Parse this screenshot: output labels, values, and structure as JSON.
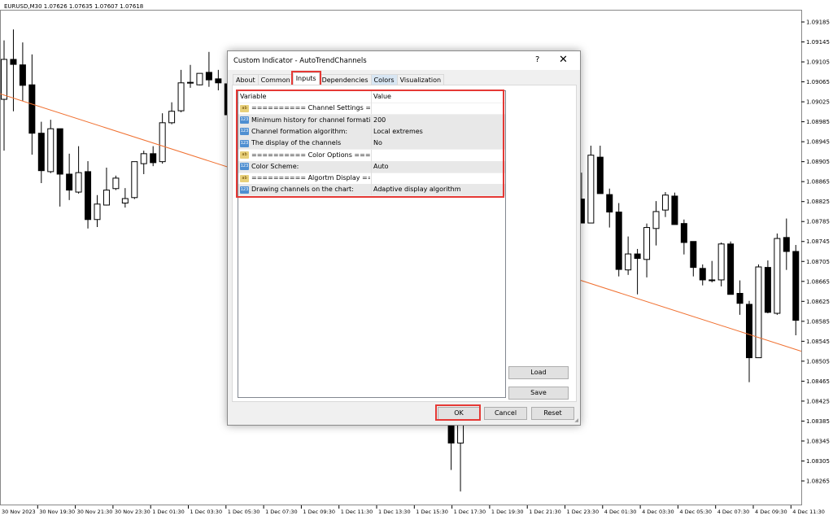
{
  "chart": {
    "symbol_line": "EURUSD,M30  1.07626 1.07635 1.07607 1.07618",
    "price_labels": [
      "1.09185",
      "1.09145",
      "1.09105",
      "1.09065",
      "1.09025",
      "1.08985",
      "1.08945",
      "1.08905",
      "1.08865",
      "1.08825",
      "1.08785",
      "1.08745",
      "1.08705",
      "1.08665",
      "1.08625",
      "1.08585",
      "1.08545",
      "1.08505",
      "1.08465",
      "1.08425",
      "1.08385",
      "1.08345",
      "1.08305",
      "1.08265"
    ],
    "time_labels": [
      "30 Nov 2023",
      "30 Nov 19:30",
      "30 Nov 21:30",
      "30 Nov 23:30",
      "1 Dec 01:30",
      "1 Dec 03:30",
      "1 Dec 05:30",
      "1 Dec 07:30",
      "1 Dec 09:30",
      "1 Dec 11:30",
      "1 Dec 13:30",
      "1 Dec 15:30",
      "1 Dec 17:30",
      "1 Dec 19:30",
      "1 Dec 21:30",
      "1 Dec 23:30",
      "4 Dec 01:30",
      "4 Dec 03:30",
      "4 Dec 05:30",
      "4 Dec 07:30",
      "4 Dec 09:30",
      "4 Dec 11:30"
    ],
    "price_range": [
      1.08265,
      1.09185
    ],
    "trendline": {
      "color": "#f07030",
      "start": {
        "bar": 0,
        "price": 1.09041
      },
      "end": {
        "bar": 86,
        "price": 1.08525
      }
    },
    "candles": [
      [
        0,
        1.0903,
        1.09148,
        1.08927,
        1.0911
      ],
      [
        1,
        1.0911,
        1.0917,
        1.09006,
        1.091
      ],
      [
        2,
        1.09099,
        1.09144,
        1.09027,
        1.09058
      ],
      [
        3,
        1.09059,
        1.0912,
        1.08919,
        1.08962
      ],
      [
        4,
        1.08962,
        1.08985,
        1.08862,
        1.08887
      ],
      [
        5,
        1.08885,
        1.08989,
        1.08882,
        1.08971
      ],
      [
        6,
        1.08971,
        1.08971,
        1.08815,
        1.0888
      ],
      [
        7,
        1.0888,
        1.08921,
        1.08828,
        1.08848
      ],
      [
        8,
        1.08844,
        1.08936,
        1.08841,
        1.08883
      ],
      [
        9,
        1.08885,
        1.08906,
        1.08771,
        1.08789
      ],
      [
        10,
        1.08789,
        1.08838,
        1.08774,
        1.0882
      ],
      [
        11,
        1.08818,
        1.08893,
        1.08817,
        1.08848
      ],
      [
        12,
        1.08851,
        1.08877,
        1.08848,
        1.08872
      ],
      [
        13,
        1.08822,
        1.08852,
        1.08813,
        1.08831
      ],
      [
        14,
        1.08833,
        1.08905,
        1.0883,
        1.08905
      ],
      [
        15,
        1.08901,
        1.08927,
        1.0888,
        1.08921
      ],
      [
        16,
        1.08921,
        1.08936,
        1.08896,
        1.08903
      ],
      [
        17,
        1.08905,
        1.09002,
        1.08901,
        1.08983
      ],
      [
        18,
        1.08983,
        1.09024,
        1.0898,
        1.09006
      ],
      [
        19,
        1.09007,
        1.09089,
        1.09004,
        1.09063
      ],
      [
        20,
        1.09064,
        1.09099,
        1.09053,
        1.09063
      ],
      [
        21,
        1.09059,
        1.09082,
        1.09058,
        1.09082
      ],
      [
        22,
        1.09084,
        1.09125,
        1.09055,
        1.09069
      ],
      [
        23,
        1.09071,
        1.09089,
        1.09048,
        1.09063
      ],
      [
        24,
        1.09061,
        1.09066,
        1.08993,
        1.08999
      ],
      [
        48,
        1.08381,
        1.084,
        1.08287,
        1.08341
      ],
      [
        49,
        1.08341,
        1.084,
        1.08244,
        1.08381
      ],
      [
        62,
        1.0883,
        1.08883,
        1.08782,
        1.08782
      ],
      [
        63,
        1.08782,
        1.08937,
        1.08782,
        1.08918
      ],
      [
        64,
        1.08914,
        1.08937,
        1.08841,
        1.08841
      ],
      [
        65,
        1.08839,
        1.08851,
        1.08773,
        1.08804
      ],
      [
        66,
        1.08804,
        1.08822,
        1.08675,
        1.08689
      ],
      [
        67,
        1.08688,
        1.08755,
        1.08678,
        1.0872
      ],
      [
        68,
        1.0872,
        1.0873,
        1.08639,
        1.08711
      ],
      [
        69,
        1.08709,
        1.08781,
        1.08673,
        1.08773
      ],
      [
        70,
        1.08771,
        1.08826,
        1.08737,
        1.08805
      ],
      [
        71,
        1.08808,
        1.08844,
        1.08794,
        1.08838
      ],
      [
        72,
        1.08836,
        1.08843,
        1.08779,
        1.08779
      ],
      [
        73,
        1.08781,
        1.08789,
        1.08719,
        1.08743
      ],
      [
        74,
        1.08745,
        1.08745,
        1.08675,
        1.08693
      ],
      [
        75,
        1.08691,
        1.08699,
        1.08657,
        1.08668
      ],
      [
        76,
        1.08668,
        1.08706,
        1.08663,
        1.08667
      ],
      [
        77,
        1.08668,
        1.08743,
        1.08655,
        1.0874
      ],
      [
        78,
        1.0874,
        1.08745,
        1.08639,
        1.08639
      ],
      [
        79,
        1.08641,
        1.08667,
        1.08598,
        1.08621
      ],
      [
        80,
        1.08619,
        1.08626,
        1.08463,
        1.08512
      ],
      [
        81,
        1.08512,
        1.08699,
        1.08512,
        1.08694
      ],
      [
        82,
        1.08693,
        1.08707,
        1.08601,
        1.08603
      ],
      [
        83,
        1.08601,
        1.08761,
        1.08598,
        1.08751
      ],
      [
        84,
        1.08753,
        1.08791,
        1.08688,
        1.08725
      ],
      [
        85,
        1.08725,
        1.08738,
        1.08557,
        1.08587
      ]
    ]
  },
  "dialog": {
    "title": "Custom Indicator - AutoTrendChannels",
    "help_glyph": "?",
    "close_glyph": "✕",
    "tabs": [
      "About",
      "Common",
      "Inputs",
      "Dependencies",
      "Colors",
      "Visualization"
    ],
    "active_tab": "Inputs",
    "table": {
      "headers": [
        "Variable",
        "Value"
      ],
      "rows": [
        {
          "type": "ab",
          "variable": "========== Channel Settings ========...",
          "value": ""
        },
        {
          "type": "123",
          "variable": "Minimum history for channel formation (b...",
          "value": "200"
        },
        {
          "type": "123",
          "variable": "Channel formation algorithm:",
          "value": "Local extremes"
        },
        {
          "type": "123",
          "variable": "The display of the channels",
          "value": "No"
        },
        {
          "type": "ab",
          "variable": "========== Color Options ==========",
          "value": ""
        },
        {
          "type": "123",
          "variable": "Color Scheme:",
          "value": "Auto"
        },
        {
          "type": "ab",
          "variable": "========== Algortm Display ==========",
          "value": ""
        },
        {
          "type": "123",
          "variable": "Drawing channels on the chart:",
          "value": "Adaptive display algorithm"
        }
      ]
    },
    "buttons": {
      "load": "Load",
      "save": "Save",
      "ok": "OK",
      "cancel": "Cancel",
      "reset": "Reset"
    },
    "highlight_color": "#e53935"
  }
}
